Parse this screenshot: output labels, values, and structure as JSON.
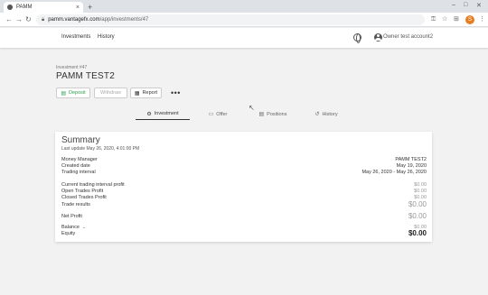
{
  "browser": {
    "tab_title": "PAMM",
    "tab_close": "×",
    "new_tab": "+",
    "url_host": "pamm.vantagefx.com",
    "url_path": "/app/investments/47",
    "profile_initial": "S"
  },
  "app": {
    "nav": [
      "Investments",
      "History"
    ],
    "user": "Owner test account2"
  },
  "investment": {
    "label": "Investment #47",
    "title": "PAMM TEST2",
    "buttons": {
      "deposit": "Deposit",
      "withdraw": "Withdraw",
      "report": "Report",
      "more": "•••"
    },
    "tabs": [
      "Investment",
      "Offer",
      "Positions",
      "History"
    ]
  },
  "summary": {
    "title": "Summary",
    "last_update": "Last update May 26, 2020, 4:01:00 PM",
    "rows": [
      {
        "label": "Money Manager",
        "value": "PAMM TEST2"
      },
      {
        "label": "Created date",
        "value": "May 19, 2020"
      },
      {
        "label": "Trading interval",
        "value": "May 26, 2020 - May 26, 2020"
      },
      {
        "label": "Current trading interval profit",
        "value": "$0.00"
      },
      {
        "label": "Open Trades Profit",
        "value": "$0.00"
      },
      {
        "label": "Closed Trades Profit",
        "value": "$0.00"
      },
      {
        "label": "Trade results",
        "value": "$0.00"
      },
      {
        "label": "Net Profit",
        "value": "$0.00"
      },
      {
        "label": "Balance",
        "value": "$0.00"
      },
      {
        "label": "Equity",
        "value": "$0.00"
      }
    ]
  },
  "colors": {
    "deposit": "#2e9e4f",
    "profile": "#e67e22"
  }
}
